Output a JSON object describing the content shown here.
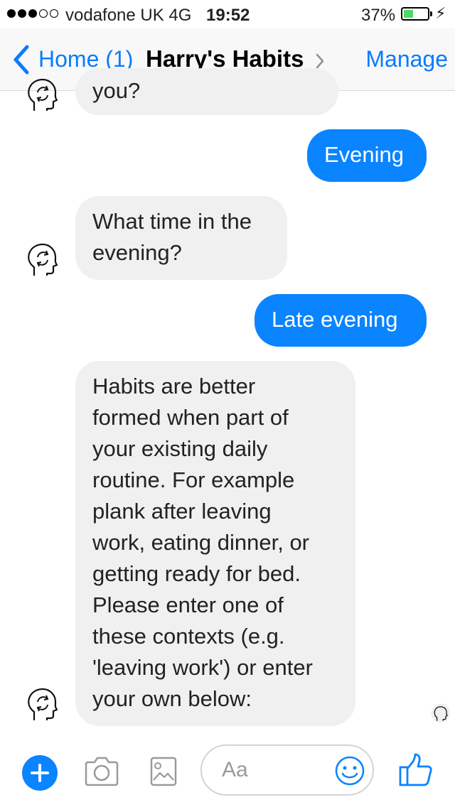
{
  "status_bar": {
    "carrier": "vodafone UK  4G",
    "time": "19:52",
    "battery": "37%",
    "battery_level": 0.37
  },
  "nav": {
    "back_label": "Home (1)",
    "title": "Harry's Habits",
    "action": "Manage"
  },
  "messages": [
    {
      "from": "bot",
      "text": "you?"
    },
    {
      "from": "user",
      "text": "Evening"
    },
    {
      "from": "bot",
      "lines": [
        "What time in the",
        "evening?"
      ]
    },
    {
      "from": "user",
      "text": "Late evening"
    },
    {
      "from": "bot",
      "lines": [
        "Habits are better",
        "formed when part of",
        "your existing daily",
        "routine. For example",
        "plank after leaving",
        "work, eating dinner, or",
        "getting ready for bed.",
        "Please enter one of",
        "these contexts (e.g.",
        "'leaving work') or enter",
        "your own below:"
      ]
    }
  ],
  "composer": {
    "placeholder": "Aa",
    "icons": [
      "plus-icon",
      "camera-icon",
      "image-icon",
      "emoji-icon",
      "thumbs-up-icon"
    ]
  },
  "colors": {
    "accent": "#0a84ff",
    "incoming_bubble": "#f0f0f0",
    "battery": "#4cd964"
  }
}
